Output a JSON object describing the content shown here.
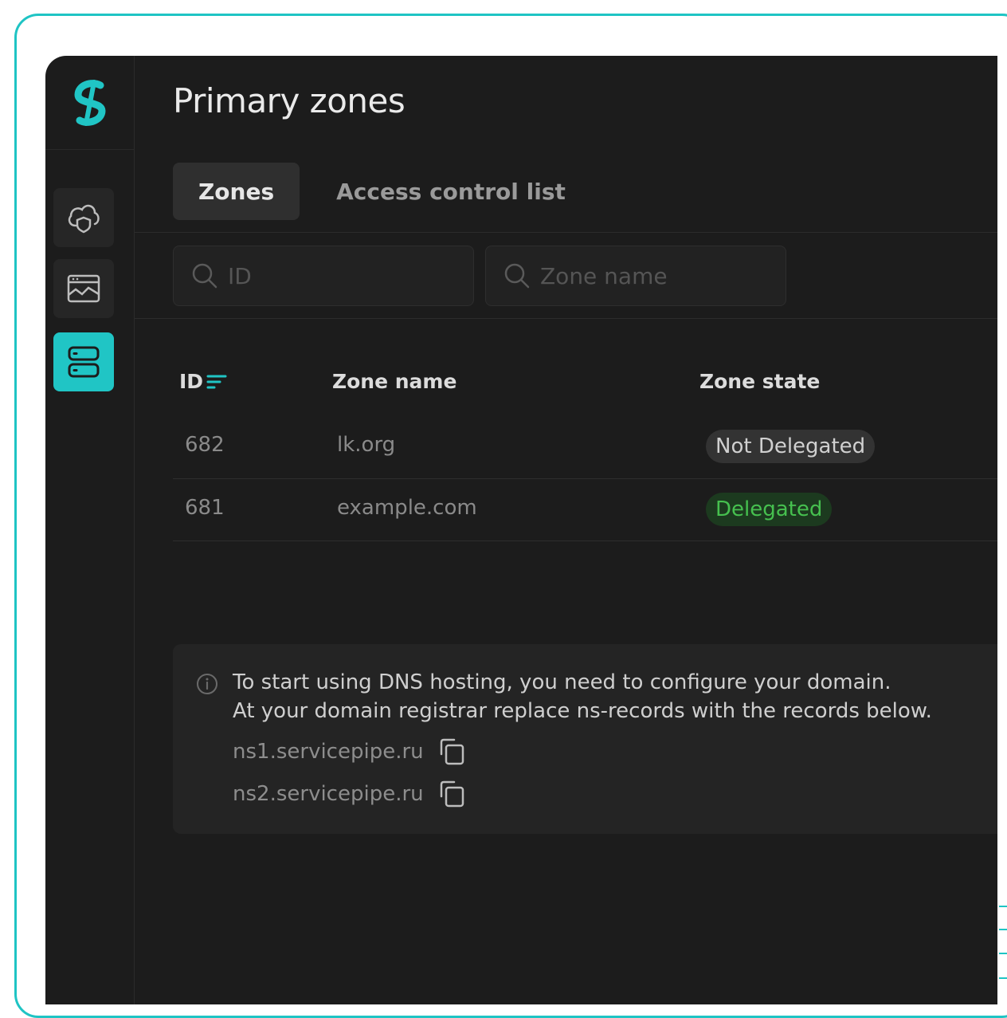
{
  "header": {
    "title": "Primary zones"
  },
  "tabs": [
    {
      "label": "Zones",
      "active": true
    },
    {
      "label": "Access control list",
      "active": false
    }
  ],
  "filters": {
    "id_placeholder": "ID",
    "zone_name_placeholder": "Zone name"
  },
  "table": {
    "columns": [
      "ID",
      "Zone name",
      "Zone state"
    ],
    "rows": [
      {
        "id": "682",
        "zone_name": "lk.org",
        "zone_state": "Not Delegated",
        "state_type": "neutral"
      },
      {
        "id": "681",
        "zone_name": "example.com",
        "zone_state": "Delegated",
        "state_type": "success"
      }
    ]
  },
  "info": {
    "line1": "To start using DNS hosting, you need to configure your domain.",
    "line2": "At your domain registrar replace ns-records with the records below.",
    "nameservers": [
      "ns1.servicepipe.ru",
      "ns2.servicepipe.ru"
    ]
  },
  "sidebar": {
    "items": [
      {
        "icon": "cloud-shield-icon",
        "active": false
      },
      {
        "icon": "monitor-chart-icon",
        "active": false
      },
      {
        "icon": "server-icon",
        "active": true
      }
    ]
  },
  "colors": {
    "accent": "#20c5c5",
    "background": "#1c1c1c",
    "success": "#46c04f",
    "frame": "#1fc4c4"
  }
}
